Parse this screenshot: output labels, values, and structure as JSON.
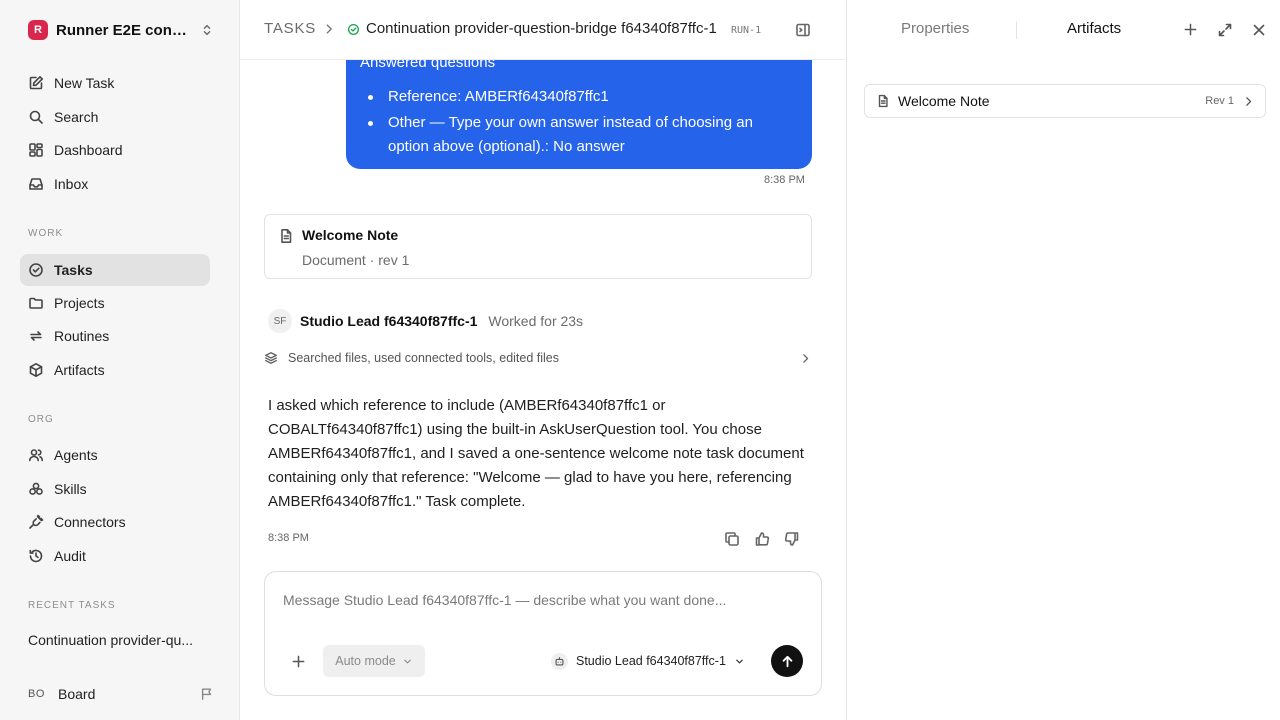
{
  "workspace": {
    "initial": "R",
    "name": "Runner E2E conti..."
  },
  "nav": {
    "new_task": "New Task",
    "search": "Search",
    "dashboard": "Dashboard",
    "inbox": "Inbox"
  },
  "work": {
    "label": "WORK",
    "tasks": "Tasks",
    "projects": "Projects",
    "routines": "Routines",
    "artifacts": "Artifacts"
  },
  "org": {
    "label": "ORG",
    "agents": "Agents",
    "skills": "Skills",
    "connectors": "Connectors",
    "audit": "Audit"
  },
  "recent": {
    "label": "RECENT TASKS",
    "items": [
      "Continuation provider-qu..."
    ]
  },
  "board": {
    "initials": "BO",
    "label": "Board"
  },
  "header": {
    "breadcrumb_root": "TASKS",
    "title": "Continuation provider-question-bridge f64340f87ffc-1",
    "run_tag": "RUN-1",
    "status_color": "#16a34a"
  },
  "chat": {
    "user_message": {
      "title": "Answered questions",
      "items": [
        "Reference: AMBERf64340f87ffc1",
        "Other — Type your own answer instead of choosing an option above (optional).: No answer"
      ],
      "time": "8:38 PM"
    },
    "artifact_card": {
      "title": "Welcome Note",
      "subtitle": "Document · rev 1"
    },
    "agent": {
      "avatar": "SF",
      "name": "Studio Lead f64340f87ffc-1",
      "worked": "Worked for 23s",
      "steps": "Searched files, used connected tools, edited files",
      "message": "I asked which reference to include (AMBERf64340f87ffc1 or COBALTf64340f87ffc1) using the built-in AskUserQuestion tool. You chose AMBERf64340f87ffc1, and I saved a one-sentence welcome note task document containing only that reference: \"Welcome — glad to have you here, referencing AMBERf64340f87ffc1.\" Task complete.",
      "time": "8:38 PM"
    }
  },
  "composer": {
    "placeholder": "Message Studio Lead f64340f87ffc-1 — describe what you want done...",
    "mode": "Auto mode",
    "agent": "Studio Lead f64340f87ffc-1"
  },
  "panel": {
    "tabs": [
      "Properties",
      "Artifacts"
    ],
    "active_tab": "Artifacts",
    "artifacts": [
      {
        "title": "Welcome Note",
        "rev": "Rev 1"
      }
    ]
  },
  "colors": {
    "accent": "#2563eb",
    "brand": "#d9264d",
    "success": "#16a34a"
  }
}
